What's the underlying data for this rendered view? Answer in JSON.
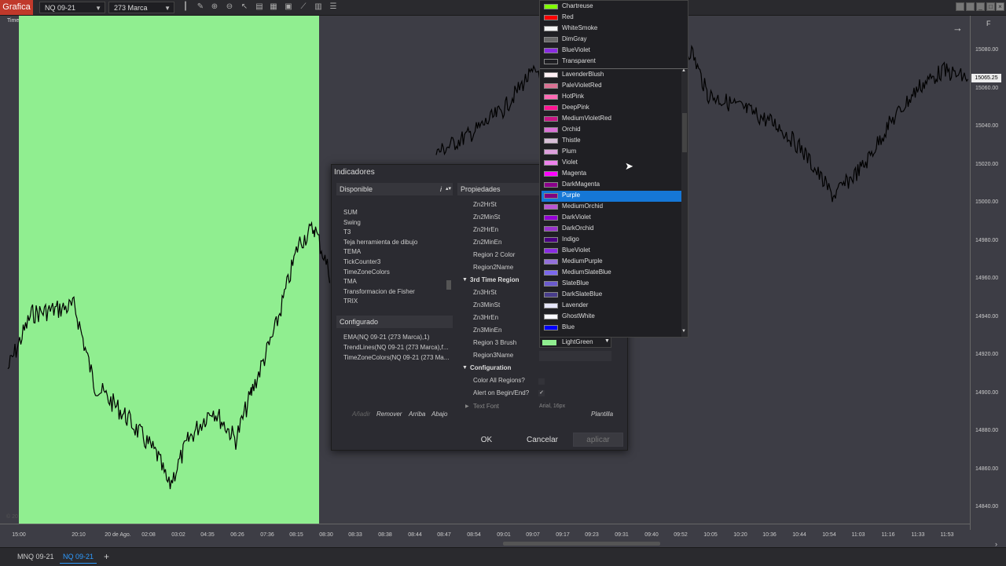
{
  "toolbar": {
    "title": "Grafica",
    "instrument": "NQ 09-21",
    "bar_type": "273 Marca"
  },
  "chart": {
    "top_label": "Time",
    "copyright": "© 20",
    "current_price": "15065.25",
    "green_color": "#90ee90",
    "price_labels": [
      "15080.00",
      "15060.00",
      "15040.00",
      "15020.00",
      "15000.00",
      "14980.00",
      "14960.00",
      "14940.00",
      "14920.00",
      "14900.00",
      "14880.00",
      "14860.00",
      "14840.00"
    ],
    "time_labels": [
      "15:00",
      "20:10",
      "20 de Ago.",
      "02:08",
      "03:02",
      "04:35",
      "06:26",
      "07:36",
      "08:15",
      "08:30",
      "08:33",
      "08:38",
      "08:44",
      "08:47",
      "08:54",
      "09:01",
      "09:07",
      "09:17",
      "09:23",
      "09:31",
      "09:40",
      "09:52",
      "10:05",
      "10:20",
      "10:36",
      "10:44",
      "10:54",
      "11:03",
      "11:16",
      "11:33",
      "11:53"
    ],
    "axis_letter": "F"
  },
  "tabs": [
    "MNQ 09-21",
    "NQ 09-21"
  ],
  "dialog": {
    "title": "Indicadores",
    "available_header": "Disponible",
    "available_items": [
      "SUM",
      "Swing",
      "T3",
      "Teja herramienta de dibujo",
      "TEMA",
      "TickCounter3",
      "TimeZoneColors",
      "TMA",
      "Transformacion de Fisher",
      "TRIX"
    ],
    "configured_header": "Configurado",
    "configured_items": [
      "EMA(NQ 09-21 (273 Marca),1)",
      "TrendLines(NQ 09-21 (273 Marca),f...",
      "TimeZoneColors(NQ 09-21 (273 Ma..."
    ],
    "actions": {
      "add": "Añadir",
      "remove": "Remover",
      "up": "Arriba",
      "down": "Abajo"
    },
    "properties_header": "Propiedades",
    "props": [
      {
        "label": "Zn2HrSt"
      },
      {
        "label": "Zn2MinSt"
      },
      {
        "label": "Zn2HrEn"
      },
      {
        "label": "Zn2MinEn"
      },
      {
        "label": "Region 2 Color"
      },
      {
        "label": "Region2Name"
      }
    ],
    "section3": "3rd Time Region",
    "props3": [
      {
        "label": "Zn3HrSt"
      },
      {
        "label": "Zn3MinSt"
      },
      {
        "label": "Zn3HrEn"
      },
      {
        "label": "Zn3MinEn"
      },
      {
        "label": "Region 3 Brush"
      },
      {
        "label": "Region3Name"
      }
    ],
    "section_config": "Configuration",
    "props_config": [
      {
        "label": "Color All Regions?"
      },
      {
        "label": "Alert on Begin/End?"
      }
    ],
    "text_font_label": "Text Font",
    "text_font_value": "Arial, 16px",
    "brush_value": "LightGreen",
    "template": "Plantilla",
    "ok": "OK",
    "cancel": "Cancelar",
    "apply": "aplicar",
    "info": "i"
  },
  "color_list_top": [
    {
      "name": "Chartreuse",
      "color": "#7fff00"
    },
    {
      "name": "Red",
      "color": "#ff0000"
    },
    {
      "name": "WhiteSmoke",
      "color": "#f5f5f5"
    },
    {
      "name": "DimGray",
      "color": "#696969"
    },
    {
      "name": "BlueViolet",
      "color": "#8a2be2"
    },
    {
      "name": "Transparent",
      "color": "transparent"
    }
  ],
  "color_list": [
    {
      "name": "LavenderBlush",
      "color": "#fff0f5"
    },
    {
      "name": "PaleVioletRed",
      "color": "#db7093"
    },
    {
      "name": "HotPink",
      "color": "#ff69b4"
    },
    {
      "name": "DeepPink",
      "color": "#ff1493"
    },
    {
      "name": "MediumVioletRed",
      "color": "#c71585"
    },
    {
      "name": "Orchid",
      "color": "#da70d6"
    },
    {
      "name": "Thistle",
      "color": "#d8bfd8"
    },
    {
      "name": "Plum",
      "color": "#dda0dd"
    },
    {
      "name": "Violet",
      "color": "#ee82ee"
    },
    {
      "name": "Magenta",
      "color": "#ff00ff"
    },
    {
      "name": "DarkMagenta",
      "color": "#8b008b"
    },
    {
      "name": "Purple",
      "color": "#800080",
      "selected": true
    },
    {
      "name": "MediumOrchid",
      "color": "#ba55d3"
    },
    {
      "name": "DarkViolet",
      "color": "#9400d3"
    },
    {
      "name": "DarkOrchid",
      "color": "#9932cc"
    },
    {
      "name": "Indigo",
      "color": "#4b0082"
    },
    {
      "name": "BlueViolet",
      "color": "#8a2be2"
    },
    {
      "name": "MediumPurple",
      "color": "#9370db"
    },
    {
      "name": "MediumSlateBlue",
      "color": "#7b68ee"
    },
    {
      "name": "SlateBlue",
      "color": "#6a5acd"
    },
    {
      "name": "DarkSlateBlue",
      "color": "#483d8b"
    },
    {
      "name": "Lavender",
      "color": "#e6e6fa"
    },
    {
      "name": "GhostWhite",
      "color": "#f8f8ff"
    },
    {
      "name": "Blue",
      "color": "#0000ff"
    }
  ]
}
